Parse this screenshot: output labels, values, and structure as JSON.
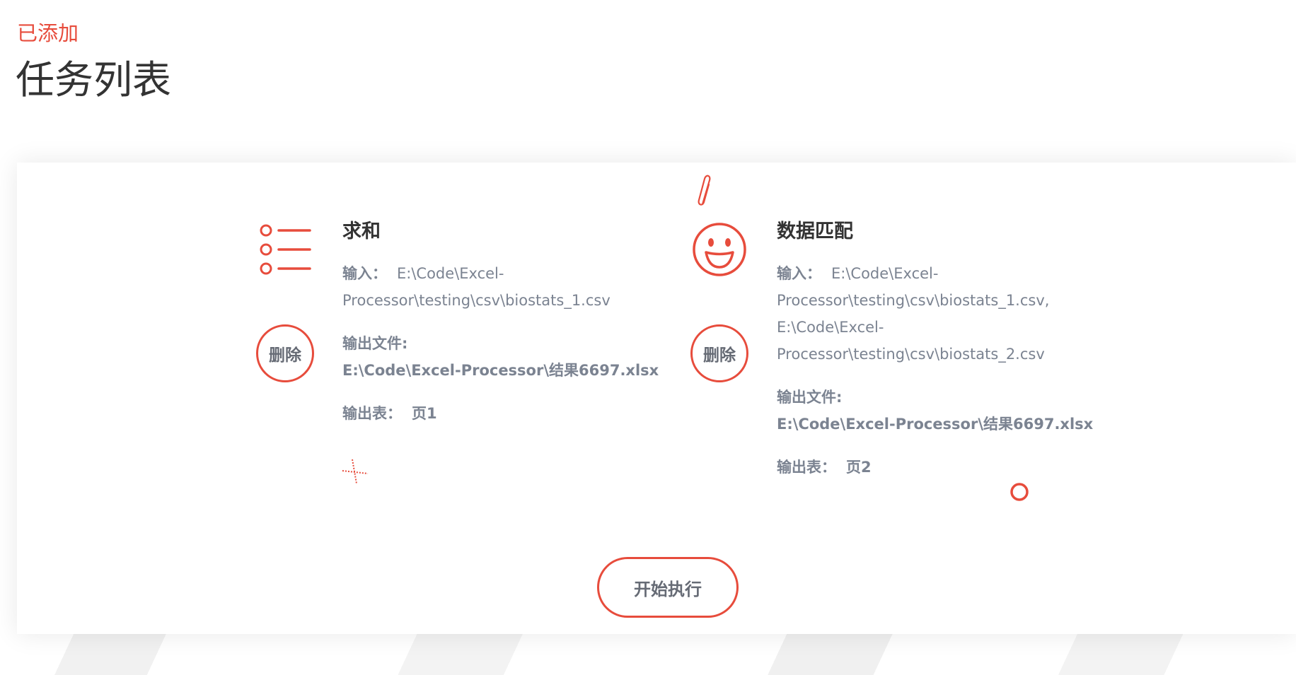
{
  "header": {
    "eyebrow": "已添加",
    "title": "任务列表"
  },
  "tasks": [
    {
      "name": "求和",
      "icon": "list-icon",
      "delete_label": "删除",
      "input_label": "输入：",
      "input_value": "E:\\Code\\Excel-Processor\\testing\\csv\\biostats_1.csv",
      "output_file_label": "输出文件:",
      "output_file_value": "E:\\Code\\Excel-Processor\\结果6697.xlsx",
      "output_sheet_label": "输出表：",
      "output_sheet_value": "页1"
    },
    {
      "name": "数据匹配",
      "icon": "smiley-icon",
      "delete_label": "删除",
      "input_label": "输入：",
      "input_value": "E:\\Code\\Excel-Processor\\testing\\csv\\biostats_1.csv, E:\\Code\\Excel-Processor\\testing\\csv\\biostats_2.csv",
      "output_file_label": "输出文件:",
      "output_file_value": "E:\\Code\\Excel-Processor\\结果6697.xlsx",
      "output_sheet_label": "输出表：",
      "output_sheet_value": "页2"
    }
  ],
  "actions": {
    "run_label": "开始执行"
  },
  "colors": {
    "accent": "#e74c3c",
    "text_dark": "#333333",
    "text_muted": "#7b8391"
  }
}
